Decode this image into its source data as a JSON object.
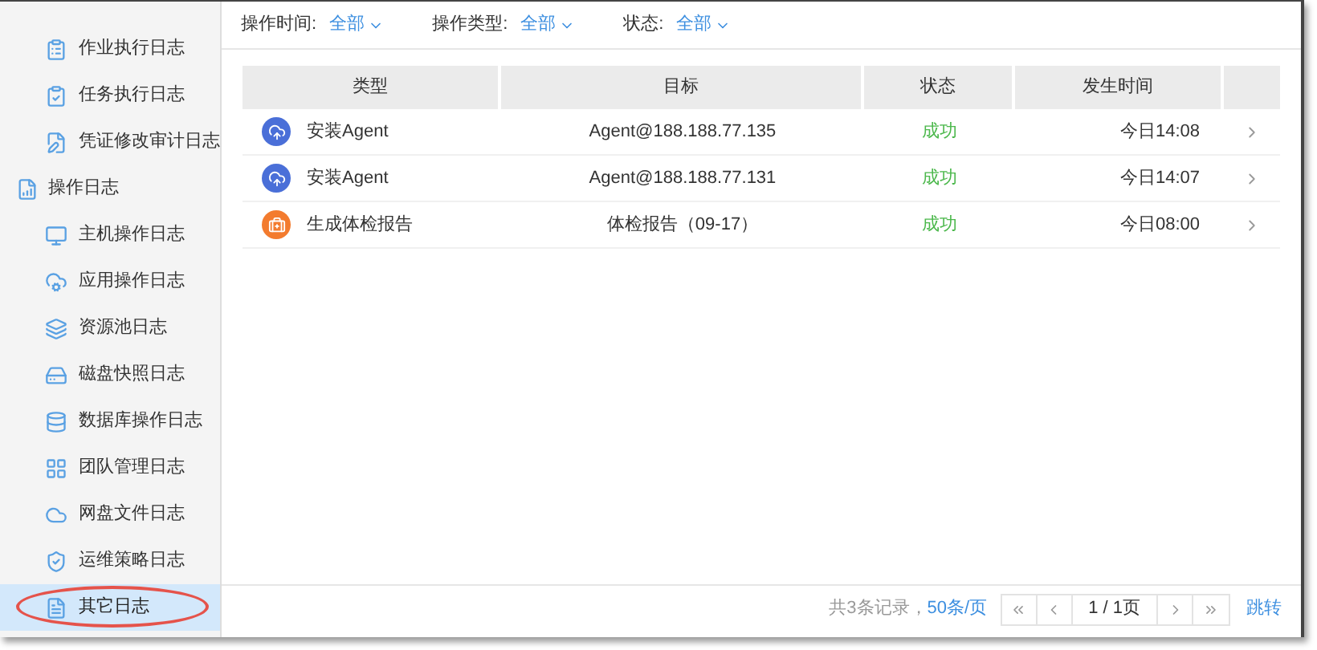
{
  "sidebar": {
    "groups": [
      {
        "items": [
          {
            "label": "作业执行日志",
            "selected": false
          },
          {
            "label": "任务执行日志",
            "selected": false
          },
          {
            "label": "凭证修改审计日志",
            "selected": false
          }
        ]
      },
      {
        "label": "操作日志",
        "items": [
          {
            "label": "主机操作日志",
            "selected": false
          },
          {
            "label": "应用操作日志",
            "selected": false
          },
          {
            "label": "资源池日志",
            "selected": false
          },
          {
            "label": "磁盘快照日志",
            "selected": false
          },
          {
            "label": "数据库操作日志",
            "selected": false
          },
          {
            "label": "团队管理日志",
            "selected": false
          },
          {
            "label": "网盘文件日志",
            "selected": false
          },
          {
            "label": "运维策略日志",
            "selected": false
          },
          {
            "label": "其它日志",
            "selected": true
          }
        ]
      }
    ]
  },
  "annotation_highlight": true,
  "filters": [
    {
      "label": "操作时间:",
      "value": "全部"
    },
    {
      "label": "操作类型:",
      "value": "全部"
    },
    {
      "label": "状态:",
      "value": "全部"
    }
  ],
  "table": {
    "columns": [
      "类型",
      "目标",
      "状态",
      "发生时间"
    ],
    "rows": [
      {
        "kind": "agent",
        "type": "安装Agent",
        "target": "Agent@188.188.77.135",
        "status": "成功",
        "time": "今日14:08"
      },
      {
        "kind": "agent",
        "type": "安装Agent",
        "target": "Agent@188.188.77.131",
        "status": "成功",
        "time": "今日14:07"
      },
      {
        "kind": "report",
        "type": "生成体检报告",
        "target": "体检报告（09-17）",
        "status": "成功",
        "time": "今日08:00"
      }
    ]
  },
  "pagination": {
    "total": "共3条记录，",
    "page_size": "50条/页",
    "page": "1 / 1页",
    "jump": "跳转"
  }
}
